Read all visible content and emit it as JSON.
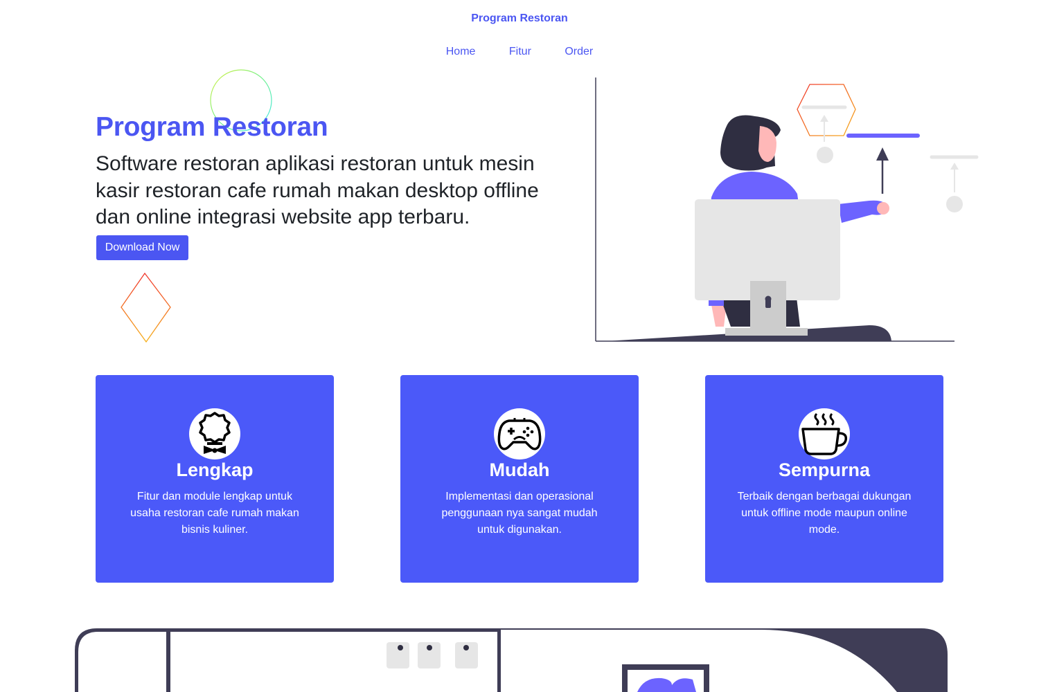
{
  "header": {
    "brand": "Program Restoran",
    "nav": [
      "Home",
      "Fitur",
      "Order"
    ]
  },
  "hero": {
    "title": "Program Restoran",
    "subtitle": "Software restoran aplikasi restoran untuk mesin kasir restoran cafe rumah makan desktop offline dan online integrasi website app terbaru.",
    "cta_label": "Download Now"
  },
  "features": [
    {
      "icon": "award-badge-icon",
      "title": "Lengkap",
      "description": "Fitur dan module lengkap untuk usaha restoran cafe rumah makan bisnis kuliner."
    },
    {
      "icon": "gamepad-icon",
      "title": "Mudah",
      "description": "Implementasi dan operasional penggunaan nya sangat mudah untuk digunakan."
    },
    {
      "icon": "coffee-cup-icon",
      "title": "Sempurna",
      "description": "Terbaik dengan berbagai dukungan untuk offline mode maupun online mode."
    }
  ],
  "colors": {
    "accent": "#4b56f2",
    "card_bg": "#4b59f9",
    "illustration_dark": "#3f3d56",
    "illustration_purple": "#6c63ff"
  }
}
